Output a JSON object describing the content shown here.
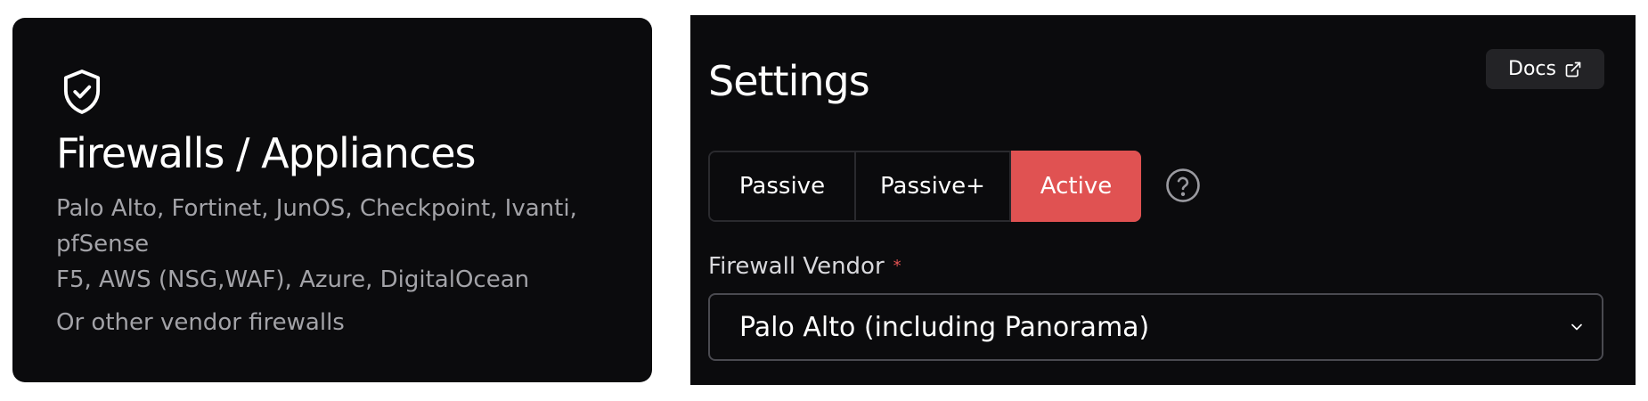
{
  "left_card": {
    "title": "Firewalls / Appliances",
    "vendors_line1": "Palo Alto, Fortinet, JunOS, Checkpoint, Ivanti,",
    "vendors_line2": "pfSense",
    "vendors_line3": "F5, AWS (NSG,WAF), Azure, DigitalOcean",
    "other_text": "Or other vendor firewalls",
    "icon": "shield-check-icon"
  },
  "settings": {
    "title": "Settings",
    "docs_label": "Docs",
    "docs_icon": "external-link-icon",
    "modes": [
      {
        "label": "Passive",
        "selected": false
      },
      {
        "label": "Passive+",
        "selected": false
      },
      {
        "label": "Active",
        "selected": true
      }
    ],
    "help_icon": "question-circle-icon",
    "vendor_field": {
      "label": "Firewall Vendor",
      "required_mark": "*",
      "selected_value": "Palo Alto (including Panorama)"
    }
  },
  "colors": {
    "card_bg": "#0b0b0d",
    "accent_active": "#e05252",
    "muted_text": "#a3a3a8",
    "button_bg": "#232326"
  }
}
